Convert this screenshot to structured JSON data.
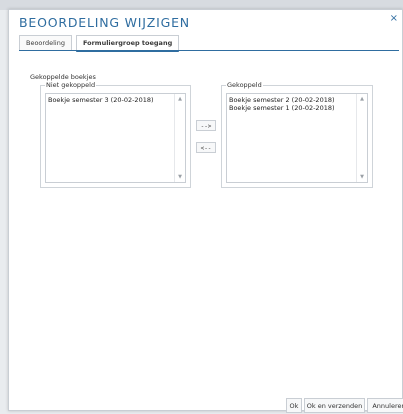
{
  "dialog": {
    "title": "BEOORDELING WIJZIGEN",
    "close_symbol": "×"
  },
  "tabs": [
    {
      "label": "Beoordeling",
      "active": false
    },
    {
      "label": "Formuliergroep toegang",
      "active": true
    }
  ],
  "section": {
    "title": "Gekoppelde boekjes"
  },
  "lists": {
    "unlinked": {
      "legend": "Niet gekoppeld",
      "items": [
        "Boekje semester 3 (20-02-2018)"
      ]
    },
    "linked": {
      "legend": "Gekoppeld",
      "items": [
        "Boekje semester 2 (20-02-2018)",
        "Boekje semester 1 (20-02-2018)"
      ]
    }
  },
  "move_buttons": {
    "to_linked": "-->",
    "to_unlinked": "<--"
  },
  "footer": {
    "ok": "Ok",
    "ok_send": "Ok en verzenden",
    "cancel": "Annuleren"
  },
  "colors": {
    "accent": "#2f6da0",
    "border": "#c9ced4"
  },
  "icons": {
    "close": "close-icon",
    "scroll_up": "chevron-up-icon",
    "scroll_down": "chevron-down-icon"
  }
}
